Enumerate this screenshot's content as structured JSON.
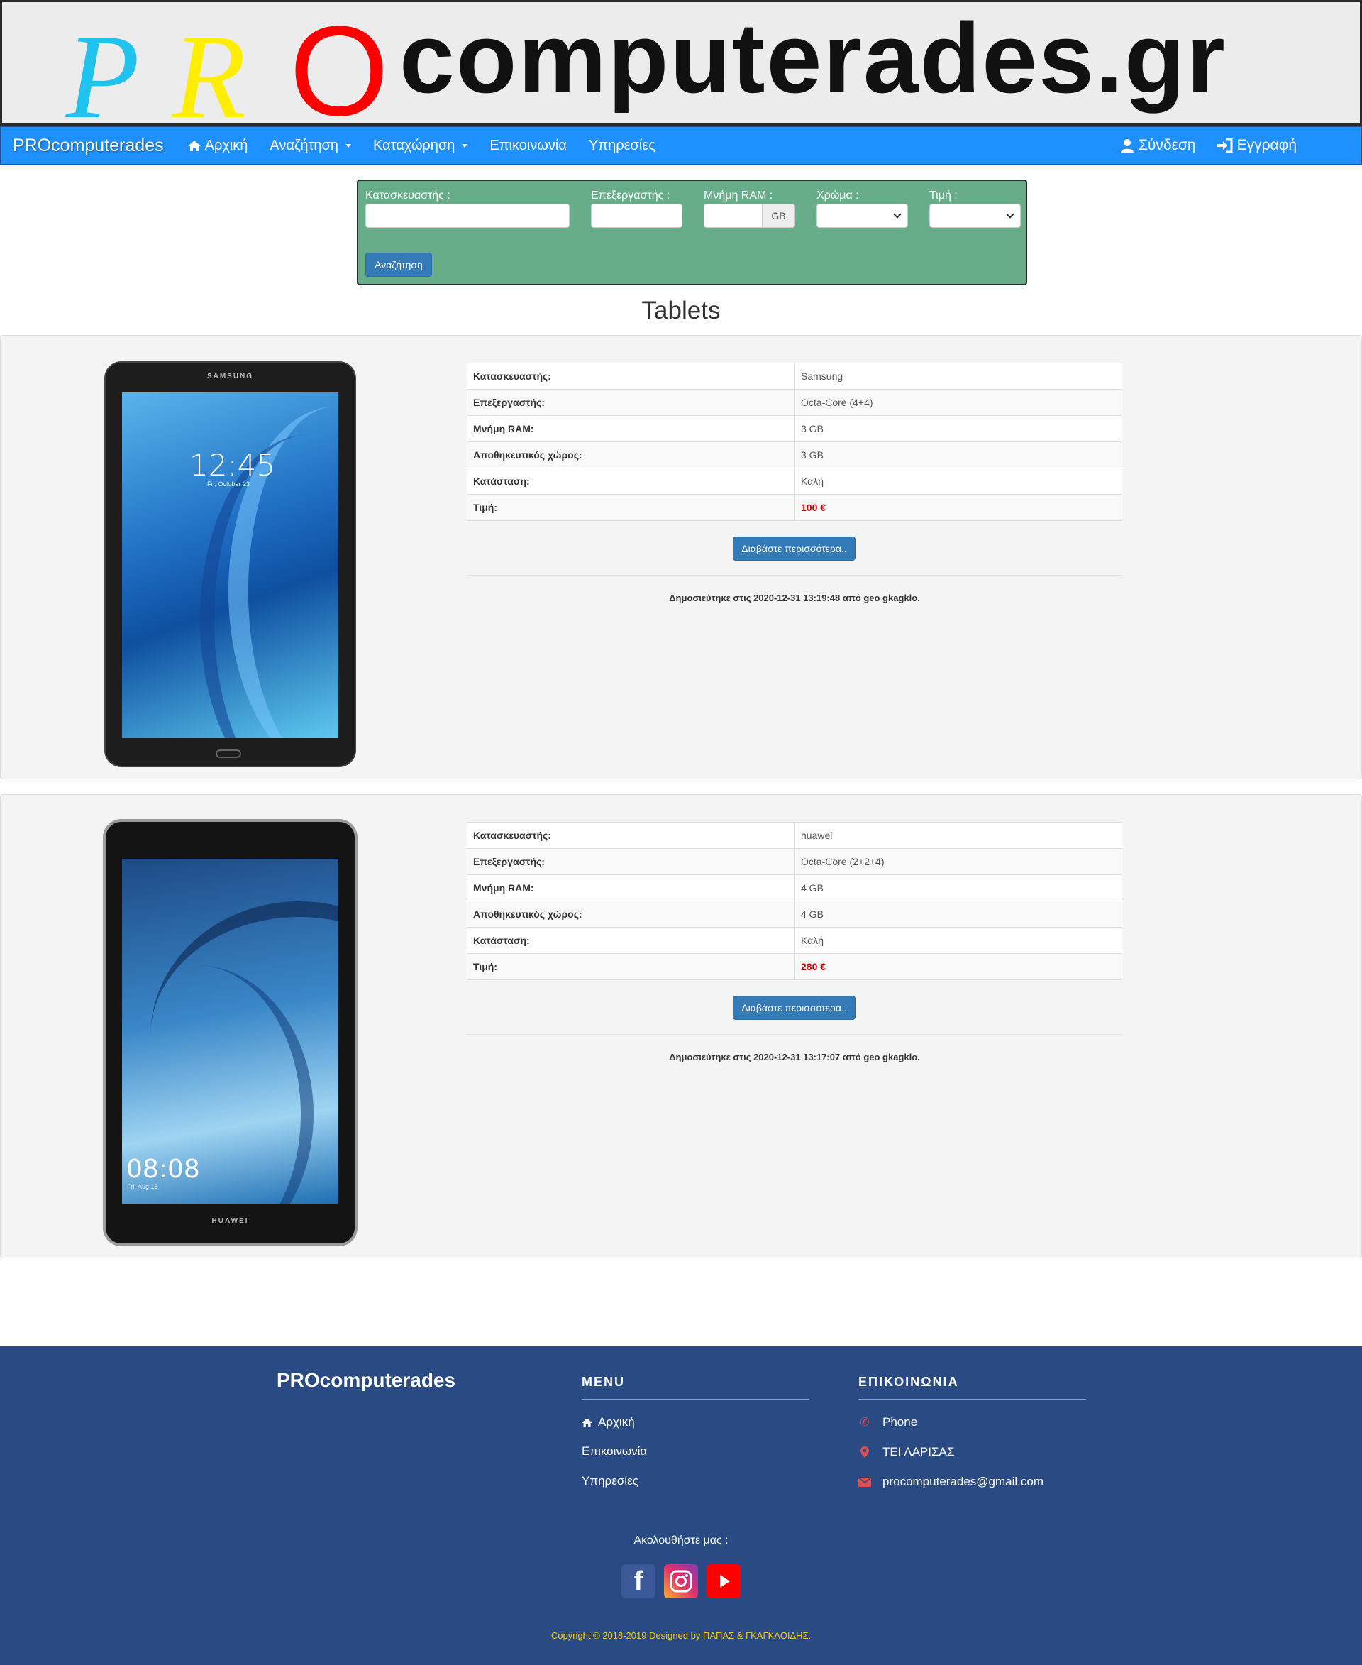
{
  "banner": {
    "logo_letters": [
      "P",
      "R",
      "O"
    ],
    "logo_rest": "computerades.gr",
    "colors": {
      "p": "#1fc3ee",
      "r": "#ffee00",
      "o": "#ff0000"
    }
  },
  "navbar": {
    "brand": "PROcomputerades",
    "items": [
      {
        "label": "Αρχική",
        "icon": "home-icon"
      },
      {
        "label": "Αναζήτηση",
        "dropdown": true
      },
      {
        "label": "Καταχώρηση",
        "dropdown": true
      },
      {
        "label": "Επικοινωνία"
      },
      {
        "label": "Υπηρεσίες"
      }
    ],
    "right": [
      {
        "label": "Σύνδεση",
        "icon": "user-icon"
      },
      {
        "label": "Εγγραφή",
        "icon": "sign-in-icon"
      }
    ],
    "color": "#1e90ff"
  },
  "search": {
    "manufacturer_label": "Κατασκευαστής :",
    "manufacturer_value": "",
    "processor_label": "Επεξεργαστής :",
    "processor_value": "",
    "ram_label": "Μνήμη RAM :",
    "ram_value": "",
    "ram_unit": "GB",
    "color_label": "Χρώμα :",
    "color_value": "",
    "price_label": "Τιμή :",
    "price_value": "",
    "button": "Αναζήτηση",
    "bg_color": "#68ad8a"
  },
  "page_title": "Tablets",
  "products": [
    {
      "specs": [
        {
          "label": "Κατασκευαστής:",
          "value": "Samsung"
        },
        {
          "label": "Επεξεργαστής:",
          "value": "Octa-Core (4+4)"
        },
        {
          "label": "Μνήμη RAM:",
          "value": "3 GB"
        },
        {
          "label": "Αποθηκευτικός χώρος:",
          "value": "3 GB"
        },
        {
          "label": "Κατάσταση:",
          "value": "Καλή"
        },
        {
          "label": "Τιμή:",
          "value": "100 €"
        }
      ],
      "button": "Διαβάστε περισσότερα..",
      "published": "Δημοσιεύτηκε στις 2020-12-31 13:19:48 από geo gkagklo.",
      "image": {
        "brand": "SAMSUNG",
        "clock": "12:45",
        "date": "Fri, October 23"
      }
    },
    {
      "specs": [
        {
          "label": "Κατασκευαστής:",
          "value": "huawei"
        },
        {
          "label": "Επεξεργαστής:",
          "value": "Octa-Core (2+2+4)"
        },
        {
          "label": "Μνήμη RAM:",
          "value": "4 GB"
        },
        {
          "label": "Αποθηκευτικός χώρος:",
          "value": "4 GB"
        },
        {
          "label": "Κατάσταση:",
          "value": "Καλή"
        },
        {
          "label": "Τιμή:",
          "value": "280 €"
        }
      ],
      "button": "Διαβάστε περισσότερα..",
      "published": "Δημοσιεύτηκε στις 2020-12-31 13:17:07 από geo gkagklo.",
      "image": {
        "brand": "HUAWEI",
        "clock": "08:08",
        "date": "Fri, Aug 18"
      }
    }
  ],
  "footer": {
    "brand": "PROcomputerades",
    "menu_heading": "MENU",
    "menu": [
      {
        "label": "Αρχική",
        "icon": "home-icon"
      },
      {
        "label": "Επικοινωνία"
      },
      {
        "label": "Υπηρεσίες"
      }
    ],
    "contact_heading": "ΕΠΙΚΟΙΝΩΝΙΑ",
    "contact": [
      {
        "label": "Phone",
        "icon": "phone-icon"
      },
      {
        "label": "ΤΕΙ ΛΑΡΙΣΑΣ",
        "icon": "map-marker-icon"
      },
      {
        "label": "procomputerades@gmail.com",
        "icon": "envelope-icon"
      }
    ],
    "follow": "Ακολουθήστε μας :",
    "social": [
      "facebook-icon",
      "instagram-icon",
      "youtube-icon"
    ],
    "copyright": "Copyright © 2018-2019 Designed by ΠΑΠΑΣ & ΓΚΑΓΚΛΟΙΔΗΣ.",
    "bg_color": "#294a82"
  }
}
